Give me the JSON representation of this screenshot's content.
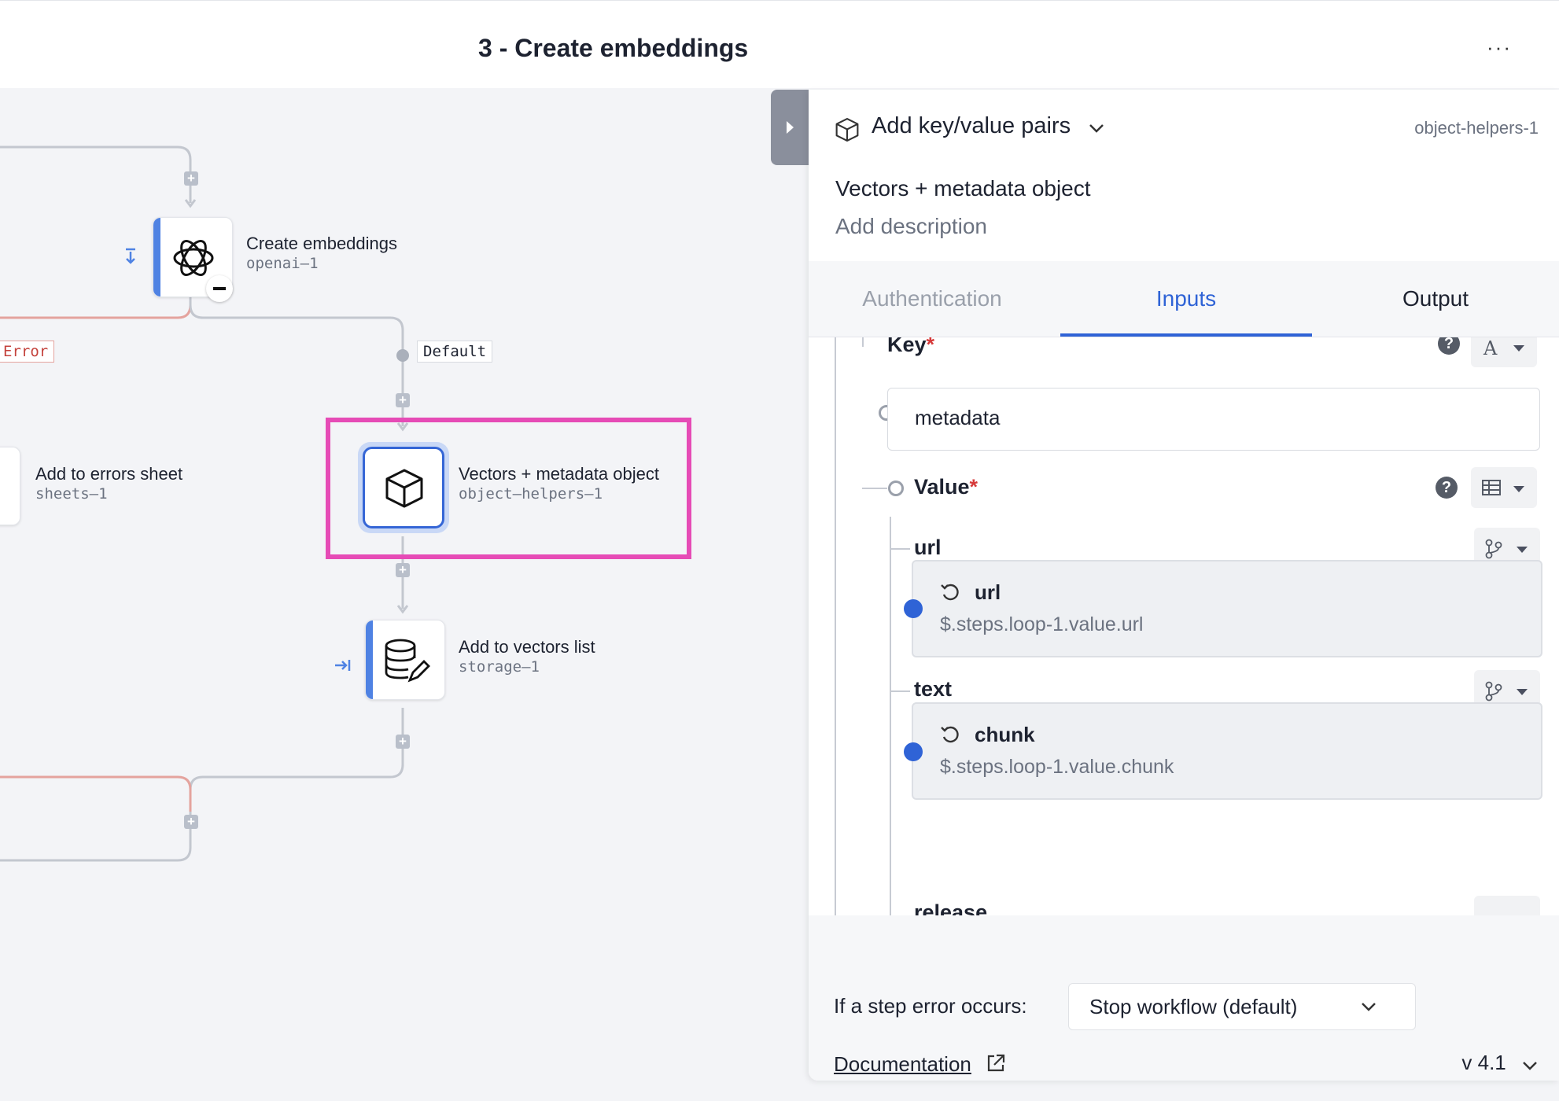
{
  "header": {
    "title": "3 - Create embeddings",
    "more": "···"
  },
  "canvas": {
    "nodes": {
      "create_embeddings": {
        "title": "Create embeddings",
        "sub": "openai–1"
      },
      "errors_sheet": {
        "title": "Add to errors sheet",
        "sub": "sheets–1"
      },
      "vectors_object": {
        "title": "Vectors + metadata object",
        "sub": "object–helpers–1"
      },
      "vectors_list": {
        "title": "Add to vectors list",
        "sub": "storage–1"
      }
    },
    "edges": {
      "error": "Error",
      "default": "Default"
    }
  },
  "panel": {
    "action": "Add key/value pairs",
    "step_id": "object-helpers-1",
    "name": "Vectors + metadata object",
    "description_placeholder": "Add description",
    "tabs": [
      "Authentication",
      "Inputs",
      "Output"
    ],
    "active_tab": "Inputs",
    "inputs": {
      "key_label": "Key",
      "required_mark": "*",
      "key_type": "A",
      "key_value": "metadata",
      "value_label": "Value",
      "fields": [
        {
          "label": "url",
          "ref_name": "url",
          "ref_path": "$.steps.loop-1.value.url"
        },
        {
          "label": "text",
          "ref_name": "chunk",
          "ref_path": "$.steps.loop-1.value.chunk"
        }
      ],
      "next_field_partial": "release"
    },
    "footer": {
      "error_label": "If a step error occurs:",
      "error_option": "Stop workflow (default)",
      "docs_link": "Documentation",
      "version": "v 4.1"
    }
  },
  "colors": {
    "accent": "#2f63d6",
    "highlight": "#e64bb6",
    "error": "#c4423c",
    "node_accent": "#4f82e3"
  }
}
